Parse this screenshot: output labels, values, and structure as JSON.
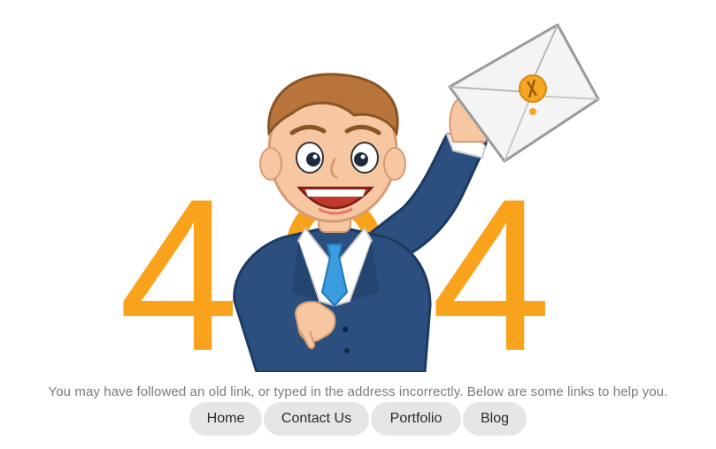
{
  "error": {
    "code_digits": [
      "4",
      "0",
      "4"
    ],
    "accent_color": "#f9a21b",
    "illustration": "businessman-holding-envelope",
    "illustration_icon": "envelope-icon",
    "message": "You may have followed an old link, or typed in the address incorrectly. Below are some links to help you."
  },
  "nav": {
    "items": [
      {
        "label": "Home"
      },
      {
        "label": "Contact Us"
      },
      {
        "label": "Portfolio"
      },
      {
        "label": "Blog"
      }
    ]
  }
}
